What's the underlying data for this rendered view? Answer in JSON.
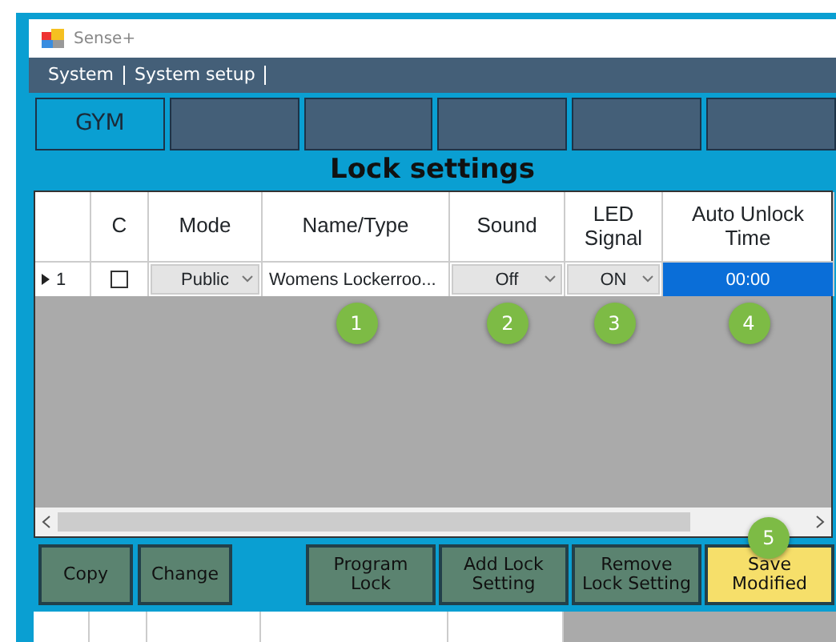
{
  "window": {
    "title": "Sense+"
  },
  "menu": [
    "System",
    "System setup"
  ],
  "tabs": [
    {
      "label": "GYM",
      "selected": true
    },
    {
      "selected": false
    },
    {
      "selected": false
    },
    {
      "selected": false
    },
    {
      "selected": false
    },
    {
      "selected": false
    }
  ],
  "section_title": "Lock settings",
  "table": {
    "columns": [
      {
        "label": "C"
      },
      {
        "label": "Mode"
      },
      {
        "label": "Name/Type",
        "callout": "1"
      },
      {
        "label": "Sound",
        "callout": "2"
      },
      {
        "label": "LED Signal",
        "callout": "3"
      },
      {
        "label": "Auto Unlock Time",
        "callout": "4"
      }
    ],
    "rows": [
      {
        "row_header": "1",
        "current": true,
        "checked": false,
        "mode": "Public",
        "name": "Womens Lockerroo...",
        "sound": "Off",
        "led": "ON",
        "auto_unlock": "00:00",
        "auto_unlock_selected": true
      }
    ]
  },
  "left_buttons": [
    {
      "label": "Copy",
      "highlighted": false
    },
    {
      "label": "Change",
      "highlighted": false
    }
  ],
  "right_buttons": [
    {
      "label": "Program Lock",
      "highlighted": false
    },
    {
      "label": "Add Lock Setting",
      "highlighted": false
    },
    {
      "label": "Remove Lock Setting",
      "highlighted": false
    },
    {
      "label": "Save Modified",
      "highlighted": true,
      "callout": "5"
    }
  ]
}
